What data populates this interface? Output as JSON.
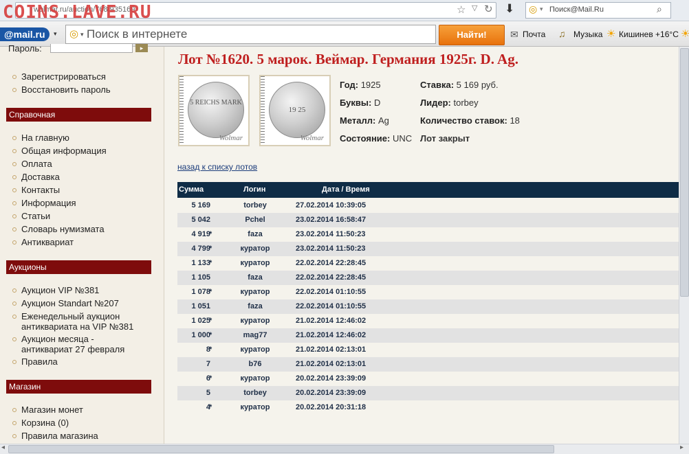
{
  "browser": {
    "url": "wolmar.ru/auction/768/935169",
    "watermark": "COINS.LAVE.RU",
    "mail_search_placeholder": "Поиск@Mail.Ru"
  },
  "toolbar": {
    "logo": "@mail.ru",
    "search_placeholder": "Поиск в интернете",
    "find_button": "Найти!",
    "links": [
      "Почта",
      "Музыка",
      "Кишинев +16°C"
    ]
  },
  "sidebar": {
    "password_label": "Пароль:",
    "account_links": [
      "Зарегистрироваться",
      "Восстановить пароль"
    ],
    "sections": [
      {
        "title": "Справочная",
        "items": [
          "На главную",
          "Общая информация",
          "Оплата",
          "Доставка",
          "Контакты",
          "Информация",
          "Статьи",
          "Словарь нумизмата",
          "Антиквариат"
        ]
      },
      {
        "title": "Аукционы",
        "items": [
          "Аукцион VIP №381",
          "Аукцион Standart №207",
          "Еженедельный аукцион антиквариата на VIP №381",
          "Аукцион месяца - антиквариат 27 февраля",
          "Правила"
        ]
      },
      {
        "title": "Магазин",
        "items": [
          "Магазин монет",
          "Корзина (0)",
          "Правила магазина"
        ]
      }
    ]
  },
  "lot": {
    "title": "Лот №1620.  5 марок. Веймар. Германия 1925г. D. Ag.",
    "coin_obverse_text": "5 REICHS MARK",
    "coin_reverse_text": "19 25",
    "watermark": "Wolmar",
    "fields": {
      "year_label": "Год:",
      "year": "1925",
      "letters_label": "Буквы:",
      "letters": "D",
      "metal_label": "Металл:",
      "metal": "Ag",
      "condition_label": "Состояние:",
      "condition": "UNC",
      "bid_label": "Ставка:",
      "bid": "5 169 руб.",
      "leader_label": "Лидер:",
      "leader": "torbey",
      "bids_count_label": "Количество ставок:",
      "bids_count": "18",
      "status": "Лот закрыт"
    },
    "back_link": "назад к списку лотов"
  },
  "bids_table": {
    "headers": [
      "Сумма",
      "Логин",
      "Дата / Время"
    ],
    "rows": [
      {
        "sum": "5 169",
        "star": "",
        "login": "torbey",
        "datetime": "27.02.2014 10:39:05"
      },
      {
        "sum": "5 042",
        "star": "",
        "login": "Pchel",
        "datetime": "23.02.2014 16:58:47"
      },
      {
        "sum": "4 919",
        "star": "*",
        "login": "faza",
        "datetime": "23.02.2014 11:50:23"
      },
      {
        "sum": "4 799",
        "star": "*",
        "login": "куратор",
        "datetime": "23.02.2014 11:50:23"
      },
      {
        "sum": "1 133",
        "star": "*",
        "login": "куратор",
        "datetime": "22.02.2014 22:28:45"
      },
      {
        "sum": "1 105",
        "star": "",
        "login": "faza",
        "datetime": "22.02.2014 22:28:45"
      },
      {
        "sum": "1 078",
        "star": "*",
        "login": "куратор",
        "datetime": "22.02.2014 01:10:55"
      },
      {
        "sum": "1 051",
        "star": "",
        "login": "faza",
        "datetime": "22.02.2014 01:10:55"
      },
      {
        "sum": "1 025",
        "star": "*",
        "login": "куратор",
        "datetime": "21.02.2014 12:46:02"
      },
      {
        "sum": "1 000",
        "star": "*",
        "login": "mag77",
        "datetime": "21.02.2014 12:46:02"
      },
      {
        "sum": "8",
        "star": "*",
        "login": "куратор",
        "datetime": "21.02.2014 02:13:01"
      },
      {
        "sum": "7",
        "star": "",
        "login": "b76",
        "datetime": "21.02.2014 02:13:01"
      },
      {
        "sum": "6",
        "star": "*",
        "login": "куратор",
        "datetime": "20.02.2014 23:39:09"
      },
      {
        "sum": "5",
        "star": "",
        "login": "torbey",
        "datetime": "20.02.2014 23:39:09"
      },
      {
        "sum": "4",
        "star": "*",
        "login": "куратор",
        "datetime": "20.02.2014 20:31:18"
      }
    ]
  },
  "colors": {
    "accent_red": "#bf1f1f",
    "section_header": "#7e0c0c",
    "table_header": "#0f2c46"
  }
}
